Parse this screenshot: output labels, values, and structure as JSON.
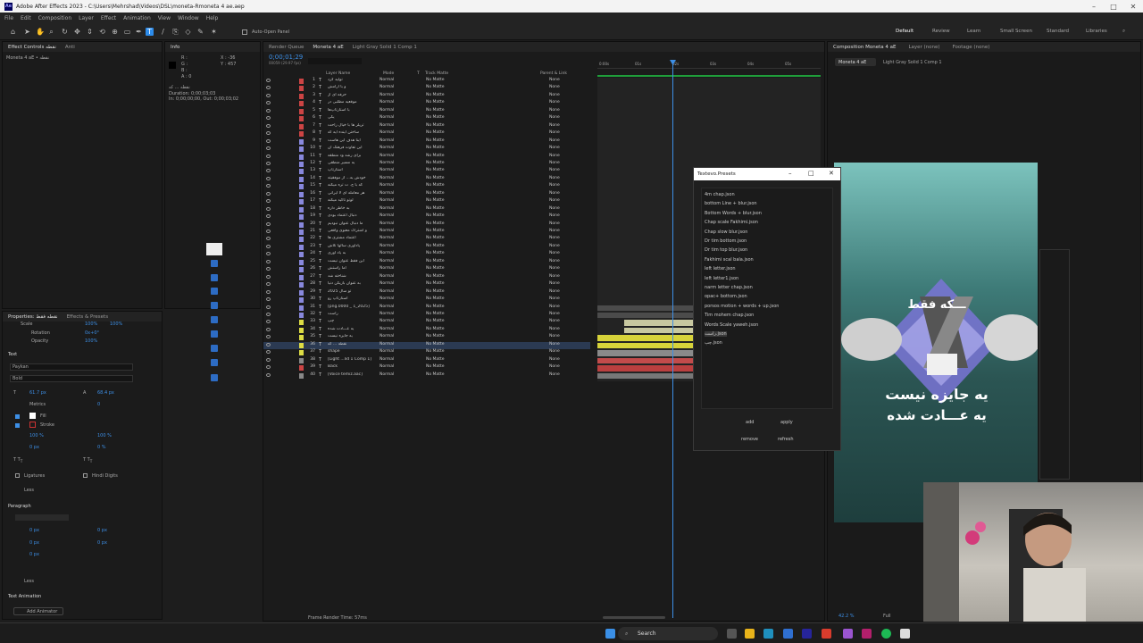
{
  "window": {
    "title": "Adobe After Effects 2023 - C:\\Users\\Mehrshad\\Videos\\DSL\\moneta-Rmoneta 4 ae.aep",
    "logo": "Ae"
  },
  "menu": [
    "File",
    "Edit",
    "Composition",
    "Layer",
    "Effect",
    "Animation",
    "View",
    "Window",
    "Help"
  ],
  "toolbar": {
    "auto_open_panel": "Auto-Open Panel",
    "workspaces": [
      "Default",
      "Review",
      "Learn",
      "Small Screen",
      "Standard",
      "Libraries"
    ],
    "active_workspace": "Default"
  },
  "project_panel": {
    "tab_effect_controls": "Effect Controls",
    "tab_effect_controls_suffix": "نقطه",
    "tab_anim": "Anti",
    "item": "Moneta 4 aE • نقطه"
  },
  "info_panel": {
    "tab": "Info",
    "r": "R :",
    "g": "G :",
    "b": "B :",
    "a": "A : 0",
    "x": "X : -36",
    "y": "Y : 457",
    "layer_name": "نقطه ... که",
    "duration": "Duration: 0;00;03;03",
    "in_out": "In: 0;00;00;00, Out: 0;00;03;02"
  },
  "properties_panel": {
    "tab_properties": "Properties: نقطه فقط",
    "tab_effects_presets": "Effects & Presets",
    "scale_label": "Scale",
    "scale_value": "100%",
    "scale_value2": "100%",
    "rotation_label": "Rotation",
    "rotation_value": "0x+0°",
    "opacity_label": "Opacity",
    "opacity_value": "100%",
    "text_section": "Text",
    "font": "Paykan",
    "style": "Bold",
    "size": "61.7 px",
    "leading": "68.4 px",
    "metrics": "Metrics",
    "tracking": "0",
    "fill": "Fill",
    "stroke": "Stroke",
    "vscale": "100 %",
    "hscale": "100 %",
    "baseline": "0 px",
    "tsume": "0 %",
    "ligatures": "Ligatures",
    "hindi_digits": "Hindi Digits",
    "less": "Less",
    "paragraph_section": "Paragraph",
    "indent_left": "0 px",
    "indent_right": "0 px",
    "space_before": "0 px",
    "space_after": "0 px",
    "indent_first": "0 px",
    "less2": "Less",
    "text_animation": "Text Animation",
    "add_animator": "Add Animator"
  },
  "timeline": {
    "tab_render_queue": "Render Queue",
    "tab_comp": "Moneta 4 aE",
    "tab_comp2": "Light Gray Solid 1 Comp 1",
    "timecode": "0;00;01;29",
    "timecode_sub": "00059 (29.97 fps)",
    "col_layer_name": "Layer Name",
    "col_mode": "Mode",
    "col_t": "T",
    "col_track_matte": "Track Matte",
    "col_parent": "Parent & Link",
    "frame_render_time": "Frame Render Time: 57ms",
    "ruler": [
      "0:00s",
      "01s",
      "02s",
      "03s",
      "04s",
      "05s"
    ],
    "layers": [
      {
        "n": "1",
        "name": "تولید کرد",
        "color": "#c44"
      },
      {
        "n": "2",
        "name": "و با آرامش",
        "color": "#c44"
      },
      {
        "n": "3",
        "name": "حرفه ای از",
        "color": "#c44"
      },
      {
        "n": "4",
        "name": "موقعیه مطلبی در",
        "color": "#c44"
      },
      {
        "n": "5",
        "name": "با استارتاپ‌ها",
        "color": "#c44"
      },
      {
        "n": "6",
        "name": "یکی",
        "color": "#c44"
      },
      {
        "n": "7",
        "name": "تریلر ها با خیال راحت",
        "color": "#c44"
      },
      {
        "n": "8",
        "name": "ساختن آینده ایه که",
        "color": "#c44"
      },
      {
        "n": "9",
        "name": "اینا هدف این هاست",
        "color": "#88d"
      },
      {
        "n": "10",
        "name": "این تفاوت فرهنگ ان",
        "color": "#88d"
      },
      {
        "n": "11",
        "name": "برای رشد ود منطقه",
        "color": "#88d"
      },
      {
        "n": "12",
        "name": "یه مسیر منطقی",
        "color": "#88d"
      },
      {
        "n": "13",
        "name": "استارتاپ",
        "color": "#88d"
      },
      {
        "n": "14",
        "name": "خودش یه... از موفقیته",
        "color": "#88d"
      },
      {
        "n": "15",
        "name": "که با ج. ت تره میکنه",
        "color": "#88d"
      },
      {
        "n": "16",
        "name": "هر معامله ای لا ایرانی",
        "color": "#88d"
      },
      {
        "n": "17",
        "name": "لوتو تاکید میکنه",
        "color": "#88d"
      },
      {
        "n": "18",
        "name": "به خاطر داره",
        "color": "#88d"
      },
      {
        "n": "19",
        "name": "دنبال اعتماد بودی",
        "color": "#88d"
      },
      {
        "n": "20",
        "name": "ما دنبال عنوان نبودیم",
        "color": "#88d"
      },
      {
        "n": "21",
        "name": "و اشتراک معنوی واقعی",
        "color": "#88d"
      },
      {
        "n": "22",
        "name": "اعتماد مشتری ها",
        "color": "#88d"
      },
      {
        "n": "23",
        "name": "پاداوری سالها تلاش",
        "color": "#88d"
      },
      {
        "n": "24",
        "name": "به یاد آوری",
        "color": "#88d"
      },
      {
        "n": "25",
        "name": "این فقط عنوان نیست",
        "color": "#88d"
      },
      {
        "n": "26",
        "name": "اما راستش",
        "color": "#88d"
      },
      {
        "n": "27",
        "name": "شناخته شد",
        "color": "#88d"
      },
      {
        "n": "28",
        "name": "به عنوان بازیکن دنیا",
        "color": "#88d"
      },
      {
        "n": "29",
        "name": "تو سال 2025",
        "color": "#88d"
      },
      {
        "n": "30",
        "name": "استارتاپ رو",
        "color": "#88d"
      },
      {
        "n": "31",
        "name": "[2025_1 _ 0000.png]",
        "color": "#88d"
      },
      {
        "n": "32",
        "name": "راست",
        "color": "#88d"
      },
      {
        "n": "33",
        "name": "چپ",
        "color": "#dd4"
      },
      {
        "n": "34",
        "name": "یه عـــادت شده",
        "color": "#dd4"
      },
      {
        "n": "35",
        "name": "یه جایزه نیست",
        "color": "#dd4"
      },
      {
        "n": "36",
        "name": "نقطه ... که",
        "color": "#dd4"
      },
      {
        "n": "37",
        "name": "shape",
        "color": "#dd4"
      },
      {
        "n": "38",
        "name": "[Light ...lid 1 Comp 1]",
        "color": "#888"
      },
      {
        "n": "39",
        "name": "Back",
        "color": "#c44"
      },
      {
        "n": "40",
        "name": "[Voice temiz.aac]",
        "color": "#888"
      }
    ],
    "mode_value": "Normal",
    "matte_value": "No Matte",
    "parent_value": "None"
  },
  "dialog": {
    "title": "Textevo.Presets",
    "presets": [
      "4m chap.json",
      "bottom Line + blur.json",
      "Bottom Words + blur.json",
      "Chap scale Fakhimi.json",
      "Chap slow blur.json",
      "Dr tim bottom.json",
      "Dr tim top blur.json",
      "Fakhimi scal bala.json",
      "left letter.json",
      "left letter1.json",
      "narm letter chap.json",
      "opac+ bottom.json",
      "porsos motion + words + up.json",
      "Tim mohem chap.json",
      "Words Scale yaweh.json",
      "راست.json",
      "چپ.json"
    ],
    "add": "add",
    "apply": "apply",
    "remove": "remove",
    "refresh": "refresh"
  },
  "composition": {
    "tab": "Composition Moneta 4 aE",
    "layer_tab": "Layer (none)",
    "footage_tab": "Footage (none)",
    "sub_tab1": "Moneta 4 aE",
    "sub_tab2": "Light Gray Solid 1 Comp 1",
    "headline": "ـــکه فقط",
    "line1": "یه جایزه نیست",
    "line2": "یه عـــادت شده",
    "zoom": "42.2 %",
    "quality": "Full"
  },
  "taskbar": {
    "search": "Search"
  }
}
